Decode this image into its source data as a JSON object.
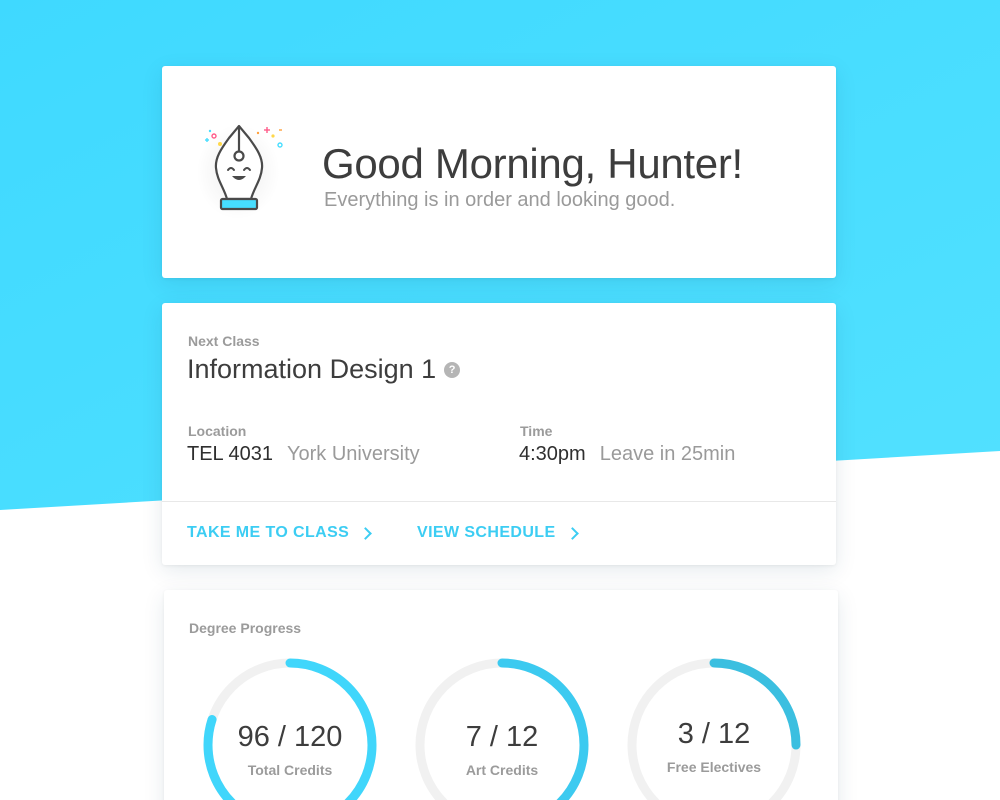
{
  "colors": {
    "background_accent": "#46ddff",
    "link": "#3ccdf3",
    "progress_light": "#40d6fb",
    "progress_dark": "#3bbfe0",
    "track": "#f1f1f1"
  },
  "greeting": {
    "mascot_icon": "pen-nib-mascot-icon",
    "title": "Good Morning, Hunter!",
    "subtitle": "Everything is in order and looking good."
  },
  "next_class": {
    "label": "Next Class",
    "title": "Information Design 1",
    "help_icon": "question-mark-icon",
    "help_glyph": "?",
    "location": {
      "label": "Location",
      "room": "TEL 4031",
      "campus": "York University"
    },
    "time": {
      "label": "Time",
      "start": "4:30pm",
      "leave": "Leave in 25min"
    },
    "actions": {
      "take_me": "TAKE ME TO CLASS",
      "view_schedule": "VIEW SCHEDULE"
    }
  },
  "degree_progress": {
    "label": "Degree Progress",
    "gauges": [
      {
        "value": "96 / 120",
        "label": "Total Credits",
        "fraction": 0.8
      },
      {
        "value": "7 / 12",
        "label": "Art Credits",
        "fraction": 0.583
      },
      {
        "value": "3 / 12",
        "label": "Free Electives",
        "fraction": 0.25
      }
    ]
  }
}
